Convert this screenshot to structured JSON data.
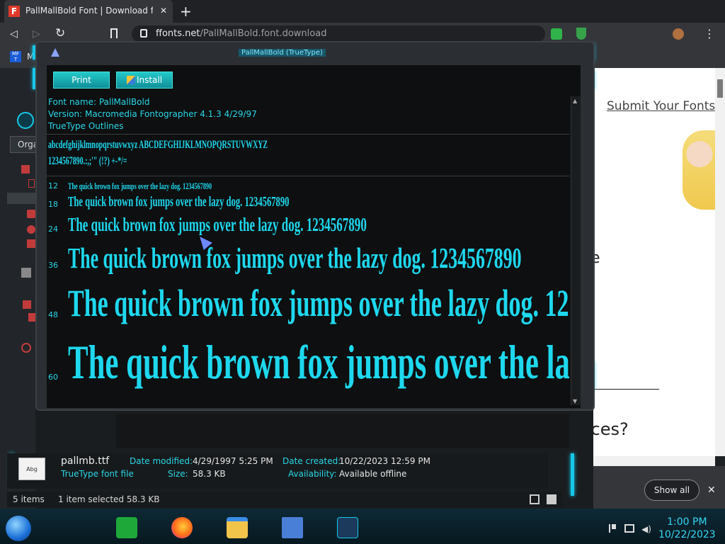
{
  "browser": {
    "tab_title": "PallMallBold Font | Download for F",
    "tab_close": "✕",
    "new_tab": "+",
    "url_host": "ffonts.net",
    "url_path": "/PallMallBold.font.download",
    "menu_icon": "⋮"
  },
  "webpage": {
    "submit_link": "Submit Your Fonts",
    "partial_text": "urces?",
    "partial_e": "e",
    "show_all": "Show all",
    "close": "✕"
  },
  "explorer": {
    "organize": "Orga",
    "side_m": "M"
  },
  "viewer": {
    "title": "PallMallBold (TrueType)",
    "print": "Print",
    "install": "Install",
    "font_name": "Font name: PallMallBold",
    "version": "Version: Macromedia Fontographer 4.1.3 4/29/97",
    "outlines": "TrueType Outlines",
    "charset_line1": "abcdefghijklmnopqrstuvwxyz ABCDEFGHIJKLMNOPQRSTUVWXYZ",
    "charset_line2": "1234567890.:,;'\" (!?) +-*/=",
    "sample_text": "The quick brown fox jumps over the lazy dog. 1234567890",
    "sizes": [
      "12",
      "18",
      "24",
      "36",
      "48",
      "60"
    ]
  },
  "details": {
    "filename": "pallmb.ttf",
    "filetype": "TrueType font file",
    "date_modified_label": "Date modified:",
    "date_modified": "4/29/1997 5:25 PM",
    "size_label": "Size:",
    "size": "58.3 KB",
    "date_created_label": "Date created:",
    "date_created": "10/22/2023 12:59 PM",
    "availability_label": "Availability:",
    "availability": "Available offline",
    "thumb_text": "Abg"
  },
  "status": {
    "items": "5 items",
    "selected": "1 item selected  58.3 KB"
  },
  "clock": {
    "time": "1:00 PM",
    "date": "10/22/2023"
  },
  "colors": {
    "accent": "#16c8e8",
    "sample": "#1ed8ee"
  }
}
